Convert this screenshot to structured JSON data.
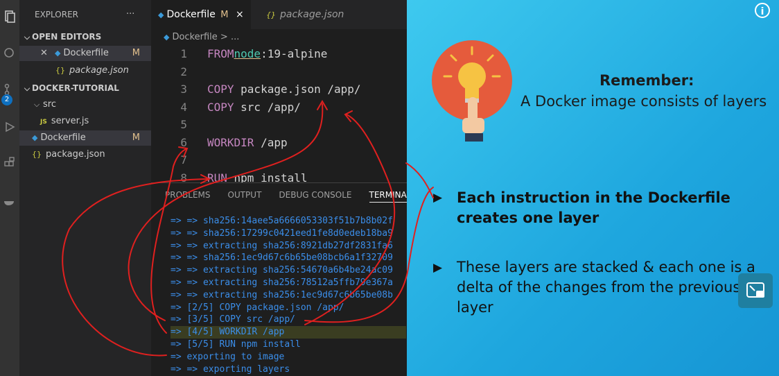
{
  "activity": {
    "badge": "2"
  },
  "sidebar": {
    "title": "EXPLORER",
    "more": "···",
    "open_editors": "OPEN EDITORS",
    "open_items": [
      {
        "name": "Dockerfile",
        "status": "M"
      },
      {
        "name": "package.json"
      }
    ],
    "folder": "DOCKER-TUTORIAL",
    "src": "src",
    "server": "server.js",
    "files": [
      {
        "name": "Dockerfile",
        "status": "M"
      },
      {
        "name": "package.json"
      }
    ]
  },
  "tabs": [
    {
      "label": "Dockerfile",
      "status": "M",
      "close": "×"
    },
    {
      "label": "package.json"
    }
  ],
  "breadcrumb": "Dockerfile > ...",
  "code": [
    {
      "n": "1",
      "kw": "FROM",
      "ul": "node",
      "rest": ":19-alpine"
    },
    {
      "n": "2",
      "kw": "",
      "ul": "",
      "rest": ""
    },
    {
      "n": "3",
      "kw": "COPY",
      "ul": "",
      "rest": " package.json /app/"
    },
    {
      "n": "4",
      "kw": "COPY",
      "ul": "",
      "rest": " src /app/"
    },
    {
      "n": "5",
      "kw": "",
      "ul": "",
      "rest": ""
    },
    {
      "n": "6",
      "kw": "WORKDIR",
      "ul": "",
      "rest": " /app"
    },
    {
      "n": "7",
      "kw": "",
      "ul": "",
      "rest": ""
    },
    {
      "n": "8",
      "kw": "RUN",
      "ul": "",
      "rest": " npm install"
    }
  ],
  "panel": {
    "tabs": [
      "PROBLEMS",
      "OUTPUT",
      "DEBUG CONSOLE",
      "TERMINAL"
    ],
    "active": 3,
    "lines": [
      "=> => sha256:14aee5a6666053303f51b7b8b02f",
      "=> => sha256:17299c0421eed1fe8d0edeb18ba9",
      "=> => extracting sha256:8921db27df2831fa6",
      "=> => sha256:1ec9d67c6b65be08bcb6a1f32709",
      "=> => extracting sha256:54670a6b4be24ac09",
      "=> => extracting sha256:78512a5ffb79e367a",
      "=> => extracting sha256:1ec9d67c6b65be08b",
      "=> [2/5] COPY package.json /app/",
      "=> [3/5] COPY src /app/",
      "=> [4/5] WORKDIR /app",
      "=> [5/5] RUN npm install",
      "=> exporting to image",
      "=> => exporting layers"
    ],
    "highlight_index": 9
  },
  "slide": {
    "heading": "Remember:",
    "subheading": "A Docker image consists of layers",
    "bullets": [
      "Each instruction in the Dockerfile creates one layer",
      "These layers are stacked & each one is a delta of the changes from the previous layer"
    ],
    "bullet_marker": "▶",
    "info": "i"
  },
  "colors": {
    "slide_bg": "#2bb8e8",
    "terminal_text": "#3b8eea",
    "keyword": "#c586c0",
    "annotation": "#e0201f"
  }
}
